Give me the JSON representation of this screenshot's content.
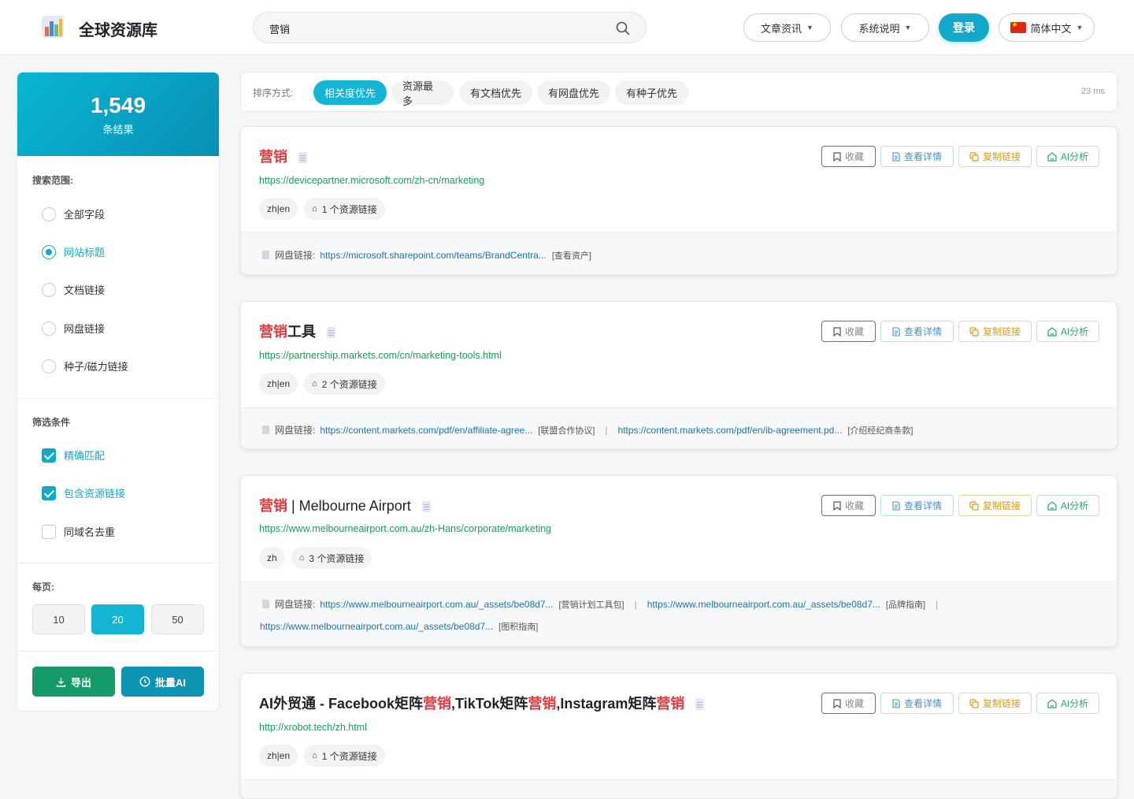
{
  "header": {
    "brand": "全球资源库",
    "search_value": "营销",
    "nav": [
      {
        "label": "文章资讯"
      },
      {
        "label": "系统说明"
      }
    ],
    "login": "登录",
    "lang": "简体中文"
  },
  "sidebar": {
    "count": "1,549",
    "count_label": "条结果",
    "scope_title": "搜索范围:",
    "scope": [
      {
        "label": "全部字段",
        "selected": false
      },
      {
        "label": "网站标题",
        "selected": true
      },
      {
        "label": "文档链接",
        "selected": false
      },
      {
        "label": "网盘链接",
        "selected": false
      },
      {
        "label": "种子/磁力链接",
        "selected": false
      }
    ],
    "filter_title": "筛选条件",
    "filters": [
      {
        "label": "精确匹配",
        "checked": true
      },
      {
        "label": "包含资源链接",
        "checked": true
      },
      {
        "label": "同域名去重",
        "checked": false
      }
    ],
    "per_page_title": "每页:",
    "per_page": [
      "10",
      "20",
      "50"
    ],
    "per_page_selected": "20",
    "export": "导出",
    "batch_ai": "批量AI",
    "colors": {
      "accent": "#13a8c9",
      "export": "#159a6a",
      "batch": "#0d93b3"
    }
  },
  "sort": {
    "label": "排序方式:",
    "options": [
      "相关度优先",
      "资源最多",
      "有文档优先",
      "有网盘优先",
      "有种子优先"
    ],
    "selected": "相关度优先",
    "time": "23 ms"
  },
  "card_actions": {
    "fav": "收藏",
    "detail": "查看详情",
    "copy": "复制链接",
    "ai": "AI分析"
  },
  "results": [
    {
      "title_hl": "营销",
      "title_rest": "",
      "title_tail": "",
      "url": "https://devicepartner.microsoft.com/zh-cn/marketing",
      "lang": "zh|en",
      "res_count": "1 个资源链接",
      "link_label": "网盘链接:",
      "links": [
        {
          "url": "https://microsoft.sharepoint.com/teams/BrandCentra...",
          "note": "[查看资产]"
        }
      ]
    },
    {
      "title_hl": "营销",
      "title_rest": "工具",
      "title_tail": "",
      "url": "https://partnership.markets.com/cn/marketing-tools.html",
      "lang": "zh|en",
      "res_count": "2 个资源链接",
      "link_label": "网盘链接:",
      "links": [
        {
          "url": "https://content.markets.com/pdf/en/affiliate-agree...",
          "note": "[联盟合作协议]"
        },
        {
          "url": "https://content.markets.com/pdf/en/ib-agreement.pd...",
          "note": "[介绍经纪商条款]"
        }
      ]
    },
    {
      "title_hl": "营销",
      "title_rest": " | Melbourne Airport",
      "title_tail": "",
      "url": "https://www.melbourneairport.com.au/zh-Hans/corporate/marketing",
      "lang": "zh",
      "res_count": "3 个资源链接",
      "link_label": "网盘链接:",
      "links": [
        {
          "url": "https://www.melbourneairport.com.au/_assets/be08d7...",
          "note": "[营销计划工具包]"
        },
        {
          "url": "https://www.melbourneairport.com.au/_assets/be08d7...",
          "note": "[品牌指南]"
        },
        {
          "url": "https://www.melbourneairport.com.au/_assets/be08d7...",
          "note": "[图积指南]"
        }
      ]
    },
    {
      "title_parts": [
        "AI外贸通 - Facebook矩阵",
        "营销",
        ",TikTok矩阵",
        "营销",
        ",Instagram矩阵",
        "营销"
      ],
      "url": "http://xrobot.tech/zh.html",
      "lang": "zh|en",
      "res_count": "1 个资源链接"
    }
  ]
}
